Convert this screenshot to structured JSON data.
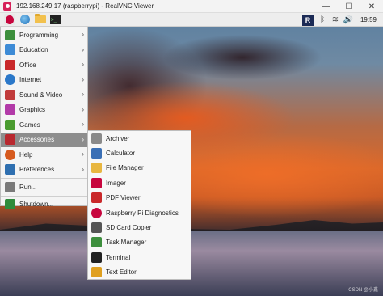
{
  "window": {
    "title": "192.168.249.17 (raspberrypi) - RealVNC Viewer",
    "controls": [
      "—",
      "☐",
      "✕"
    ]
  },
  "taskbar": {
    "clock": "19:59",
    "vnc_label": "R",
    "bluetooth_symbol": "ᛒ",
    "wifi_symbol": "≋",
    "volume_symbol": "🔊"
  },
  "menu": {
    "items": [
      {
        "label": "Programming",
        "icon": "programming-icon",
        "color": "#3c8f3c",
        "arrow": "›"
      },
      {
        "label": "Education",
        "icon": "education-icon",
        "color": "#3d8bd6",
        "arrow": "›"
      },
      {
        "label": "Office",
        "icon": "office-icon",
        "color": "#c9282a",
        "arrow": "›"
      },
      {
        "label": "Internet",
        "icon": "internet-icon",
        "color": "#2b78c9",
        "arrow": "›"
      },
      {
        "label": "Sound & Video",
        "icon": "sound-video-icon",
        "color": "#c13b3b",
        "arrow": "›"
      },
      {
        "label": "Graphics",
        "icon": "graphics-icon",
        "color": "#b23aa8",
        "arrow": "›"
      },
      {
        "label": "Games",
        "icon": "games-icon",
        "color": "#4a9b2f",
        "arrow": "›"
      },
      {
        "label": "Accessories",
        "icon": "accessories-icon",
        "color": "#b8282f",
        "arrow": "›"
      },
      {
        "label": "Help",
        "icon": "help-icon",
        "color": "#d65a1e",
        "arrow": "›"
      },
      {
        "label": "Preferences",
        "icon": "preferences-icon",
        "color": "#2e6fb0",
        "arrow": "›"
      },
      {
        "label": "Run...",
        "icon": "run-icon",
        "color": "#7a7a7a",
        "arrow": ""
      },
      {
        "label": "Shutdown...",
        "icon": "shutdown-icon",
        "color": "#2e8b3b",
        "arrow": ""
      }
    ]
  },
  "submenu": {
    "items": [
      {
        "label": "Archiver",
        "icon": "archiver-icon",
        "color": "#8a8a8a"
      },
      {
        "label": "Calculator",
        "icon": "calculator-icon",
        "color": "#3a6fb5"
      },
      {
        "label": "File Manager",
        "icon": "file-manager-icon",
        "color": "#e8b640"
      },
      {
        "label": "Imager",
        "icon": "imager-icon",
        "color": "#c7053d"
      },
      {
        "label": "PDF Viewer",
        "icon": "pdf-viewer-icon",
        "color": "#c9282a"
      },
      {
        "label": "Raspberry Pi Diagnostics",
        "icon": "raspberry-pi-diagnostics-icon",
        "color": "#c7053d"
      },
      {
        "label": "SD Card Copier",
        "icon": "sd-card-copier-icon",
        "color": "#555555"
      },
      {
        "label": "Task Manager",
        "icon": "task-manager-icon",
        "color": "#3d8f3d"
      },
      {
        "label": "Terminal",
        "icon": "terminal-icon",
        "color": "#222222"
      },
      {
        "label": "Text Editor",
        "icon": "text-editor-icon",
        "color": "#e0a020"
      }
    ]
  },
  "desktop": {
    "watermark": "CSDN @小鑫"
  }
}
